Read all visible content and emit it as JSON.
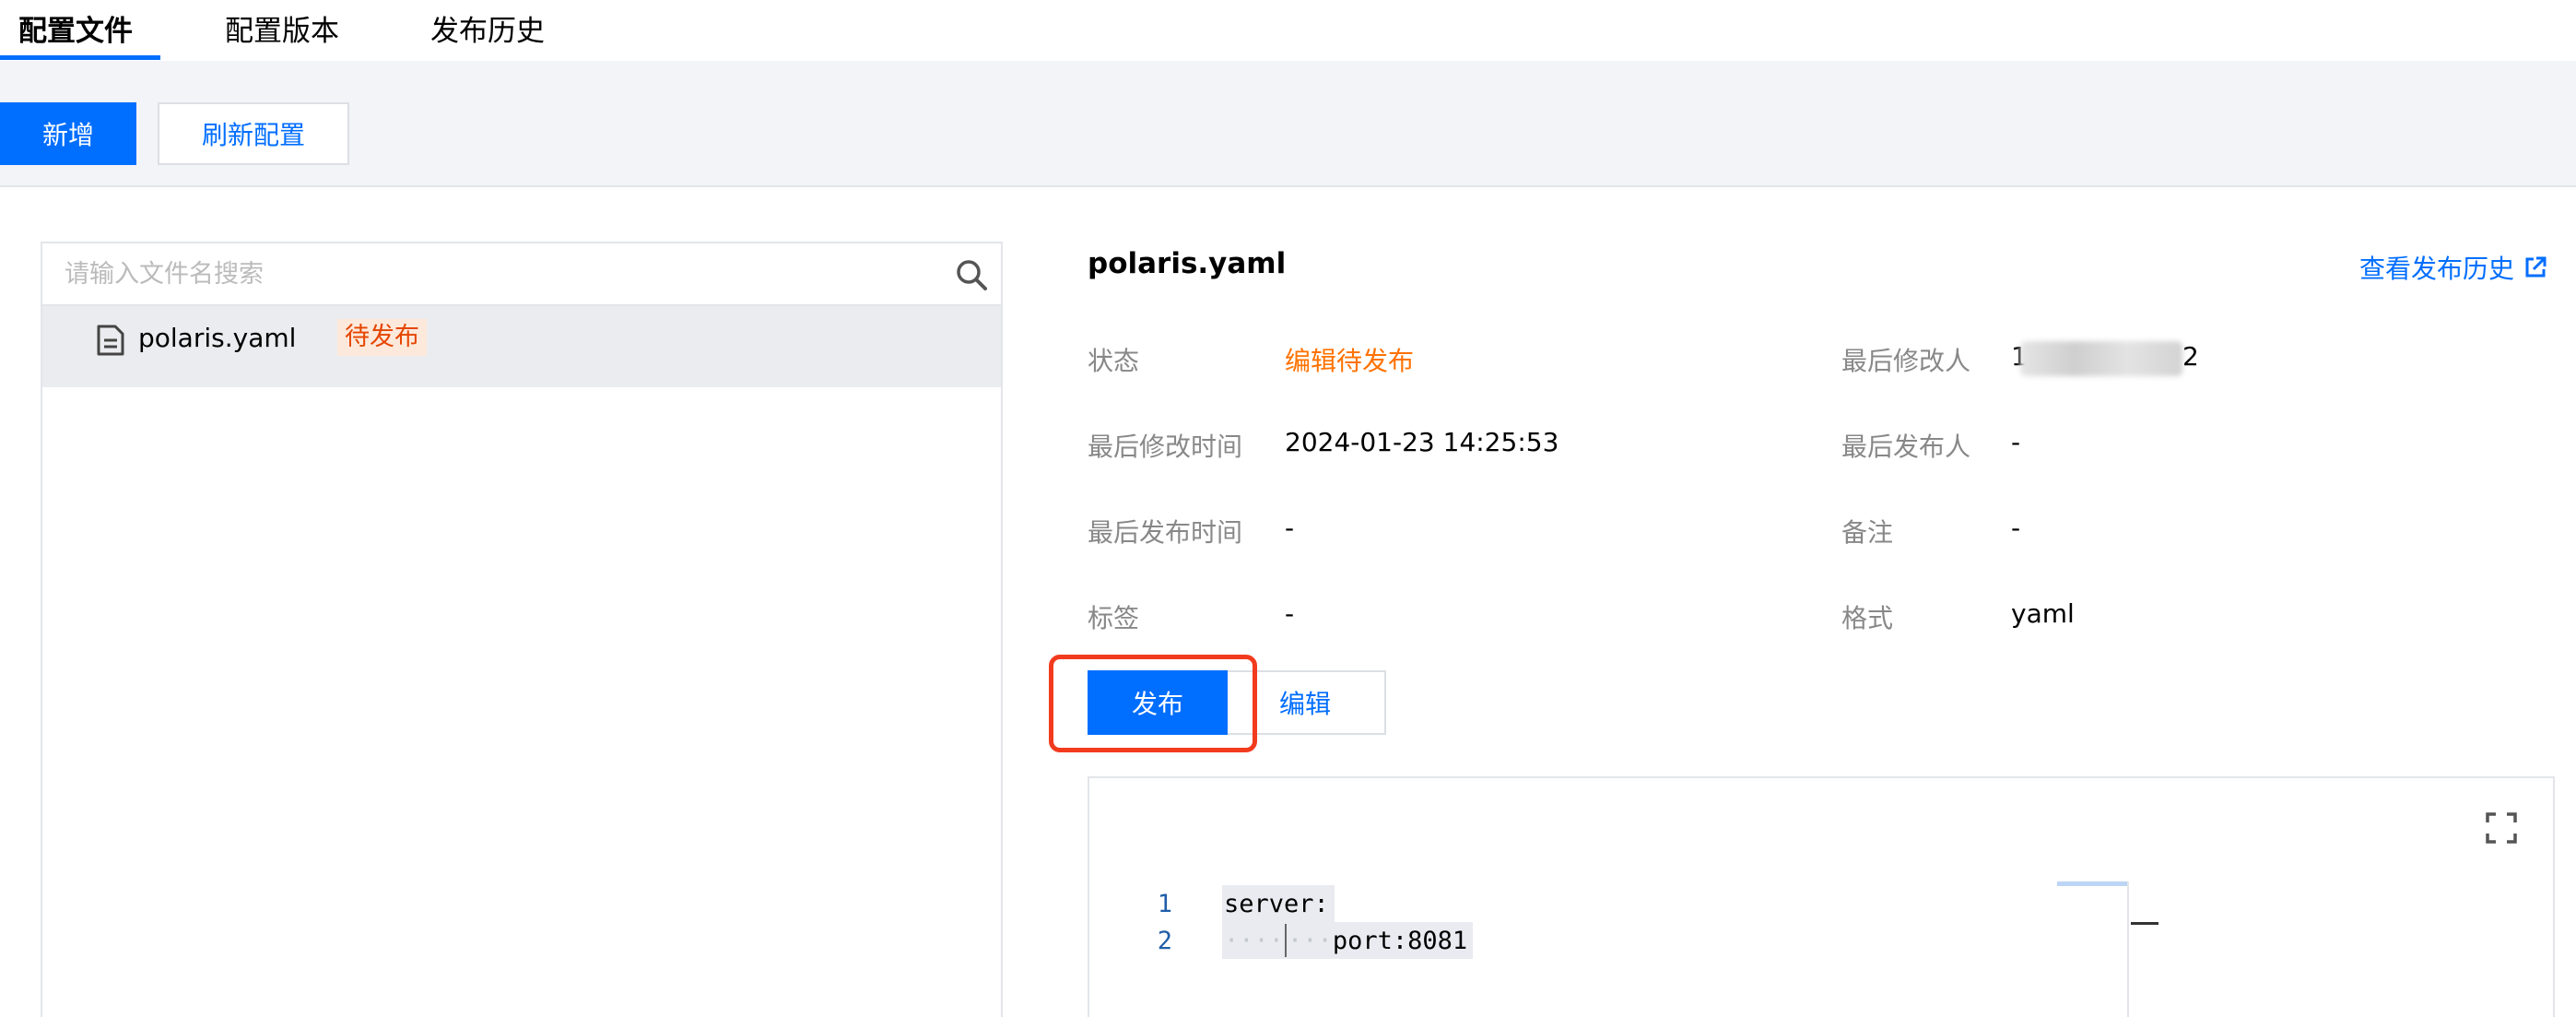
{
  "tabs": [
    {
      "label": "配置文件",
      "active": true
    },
    {
      "label": "配置版本",
      "active": false
    },
    {
      "label": "发布历史",
      "active": false
    }
  ],
  "toolbar": {
    "add_label": "新增",
    "refresh_label": "刷新配置"
  },
  "file_list": {
    "search_placeholder": "请输入文件名搜索",
    "items": [
      {
        "name": "polaris.yaml",
        "badge": "待发布"
      }
    ]
  },
  "detail": {
    "title": "polaris.yaml",
    "history_link": "查看发布历史",
    "fields": {
      "status": {
        "label": "状态",
        "value": "编辑待发布"
      },
      "last_modifier": {
        "label": "最后修改人",
        "value_prefix": "1",
        "value_suffix": "2"
      },
      "last_modified_time": {
        "label": "最后修改时间",
        "value": "2024-01-23 14:25:53"
      },
      "last_publisher": {
        "label": "最后发布人",
        "value": "-"
      },
      "last_publish_time": {
        "label": "最后发布时间",
        "value": "-"
      },
      "remark": {
        "label": "备注",
        "value": "-"
      },
      "tags": {
        "label": "标签",
        "value": "-"
      },
      "format": {
        "label": "格式",
        "value": "yaml"
      }
    },
    "publish_label": "发布",
    "edit_label": "编辑"
  },
  "editor": {
    "lines": [
      {
        "no": "1",
        "text": "server:"
      },
      {
        "no": "2",
        "text": "port:8081"
      }
    ]
  },
  "colors": {
    "primary": "#006eff",
    "warning": "#ff7200",
    "badge_bg": "#fde9db",
    "highlight": "#f23b1e"
  }
}
